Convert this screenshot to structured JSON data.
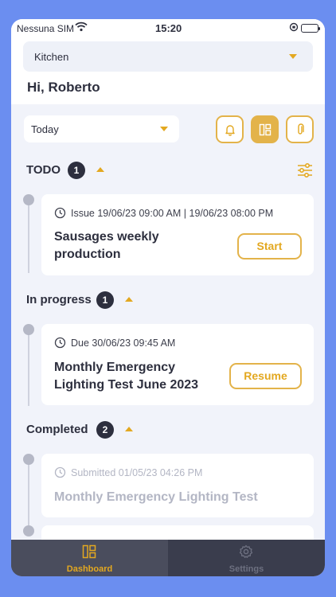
{
  "status_bar": {
    "carrier": "Nessuna SIM",
    "time": "15:20"
  },
  "location_select": {
    "value": "Kitchen"
  },
  "greeting": "Hi, Roberto",
  "period_select": {
    "value": "Today"
  },
  "toolbar": {
    "icons": [
      "bell-icon",
      "dashboard-icon",
      "attachment-icon"
    ],
    "active": "dashboard-icon"
  },
  "sections": {
    "todo": {
      "title": "TODO",
      "count": "1",
      "task": {
        "meta": "Issue 19/06/23 09:00 AM | 19/06/23 08:00 PM",
        "title_line1": "Sausages weekly",
        "title_line2": "production",
        "action": "Start"
      }
    },
    "in_progress": {
      "title": "In progress",
      "count": "1",
      "task": {
        "meta": "Due 30/06/23 09:45 AM",
        "title_line1": "Monthly Emergency",
        "title_line2": "Lighting Test  June 2023",
        "action": "Resume"
      }
    },
    "completed": {
      "title": "Completed",
      "count": "2",
      "task": {
        "meta": "Submitted 01/05/23 04:26 PM",
        "title": "Monthly Emergency Lighting Test"
      }
    }
  },
  "tabbar": {
    "dashboard": "Dashboard",
    "settings": "Settings"
  },
  "colors": {
    "accent": "#e3a820",
    "dark": "#2d2f3e",
    "background": "#6b8ef0"
  }
}
